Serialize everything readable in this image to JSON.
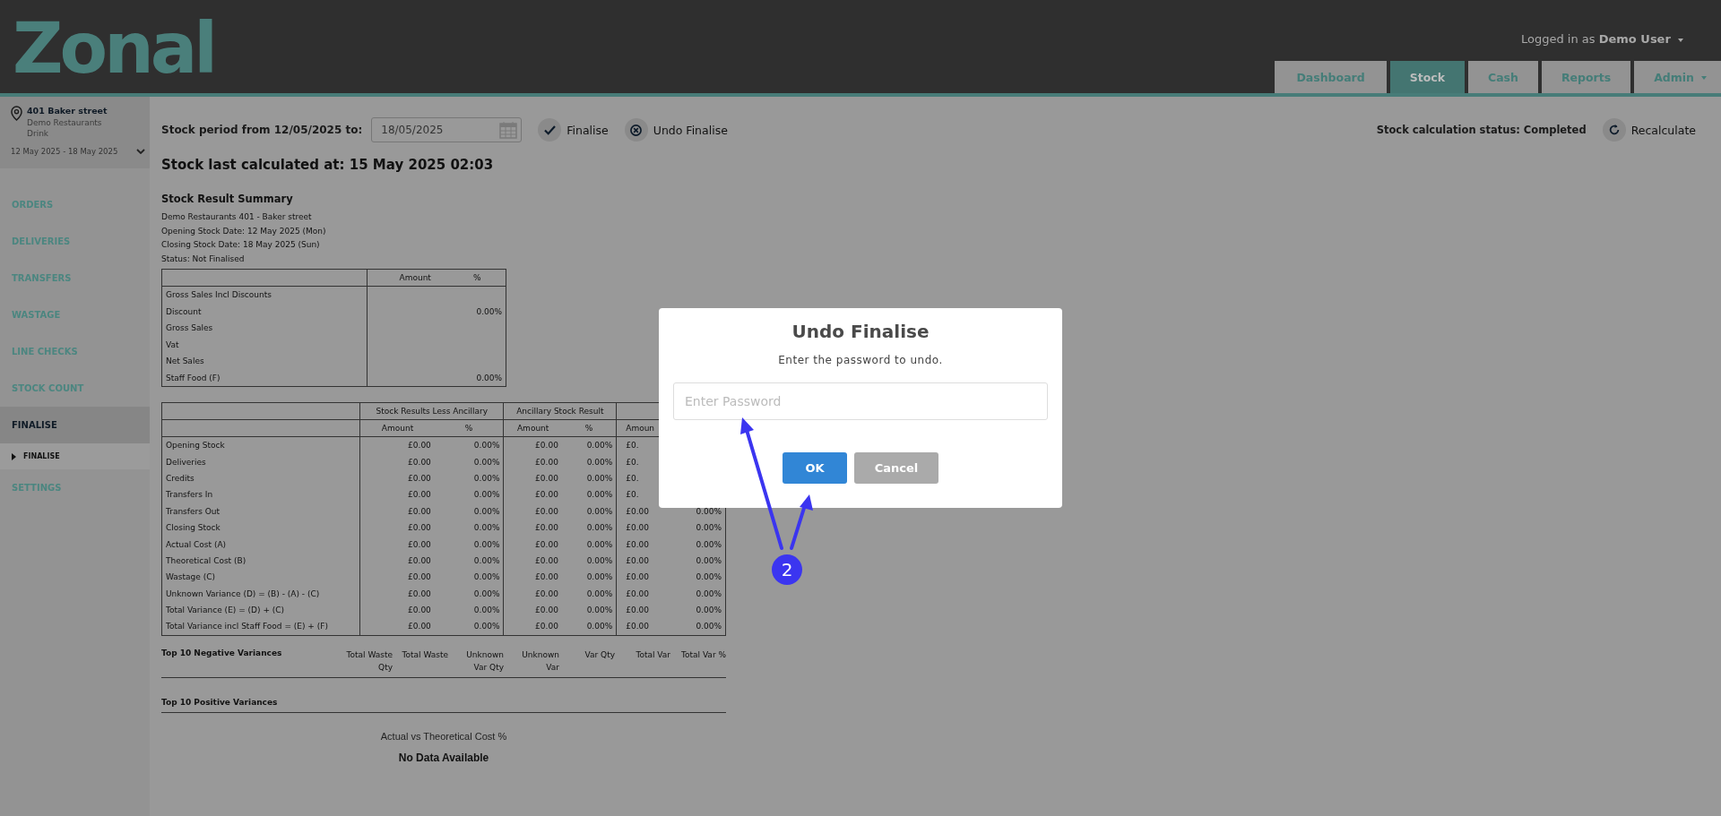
{
  "header": {
    "logo": "Zonal",
    "user_prefix": "Logged in as",
    "user_name": "Demo User"
  },
  "tabs": [
    {
      "label": "Dashboard",
      "selected": false,
      "dropdown": false
    },
    {
      "label": "Stock",
      "selected": true,
      "dropdown": false
    },
    {
      "label": "Cash",
      "selected": false,
      "dropdown": false
    },
    {
      "label": "Reports",
      "selected": false,
      "dropdown": false
    },
    {
      "label": "Admin",
      "selected": false,
      "dropdown": true
    }
  ],
  "sidebar": {
    "location": {
      "name": "401 Baker street",
      "company": "Demo Restaurants",
      "category": "Drink",
      "period": "12 May 2025 - 18 May 2025"
    },
    "items": [
      {
        "label": "ORDERS",
        "selected": false
      },
      {
        "label": "DELIVERIES",
        "selected": false
      },
      {
        "label": "TRANSFERS",
        "selected": false
      },
      {
        "label": "WASTAGE",
        "selected": false
      },
      {
        "label": "LINE CHECKS",
        "selected": false
      },
      {
        "label": "STOCK COUNT",
        "selected": false
      },
      {
        "label": "FINALISE",
        "selected": true,
        "children": [
          {
            "label": "FINALISE",
            "selected": true
          }
        ]
      },
      {
        "label": "SETTINGS",
        "selected": false
      }
    ]
  },
  "toolbar": {
    "period_label": "Stock period from 12/05/2025 to:",
    "date_value": "18/05/2025",
    "finalise": "Finalise",
    "undo_finalise": "Undo Finalise",
    "status": "Stock calculation status: Completed",
    "recalculate": "Recalculate"
  },
  "last_calculated": "Stock last calculated at: 15 May 2025 02:03",
  "summary": {
    "title": "Stock Result Summary",
    "lines": [
      "Demo Restaurants  401 - Baker street",
      "Opening Stock Date: 12 May 2025 (Mon)",
      "Closing Stock Date: 18 May 2025 (Sun)",
      "Status: Not Finalised"
    ],
    "columns": [
      "Amount",
      "%"
    ],
    "rows": [
      {
        "label": "Gross Sales Incl Discounts"
      },
      {
        "label": "Discount",
        "percent": "0.00%"
      },
      {
        "label": "Gross Sales"
      },
      {
        "label": "Vat"
      },
      {
        "label": "Net Sales"
      },
      {
        "label": "Staff Food (F)",
        "percent": "0.00%"
      }
    ]
  },
  "results": {
    "groups": [
      "Stock Results Less Ancillary",
      "Ancillary Stock Result"
    ],
    "subcolumns": [
      "Amount",
      "%",
      "Amount",
      "%",
      "Amoun"
    ],
    "rows": [
      {
        "label": "Opening Stock",
        "values": [
          "£0.00",
          "0.00%",
          "£0.00",
          "0.00%",
          "£0."
        ]
      },
      {
        "label": "Deliveries",
        "values": [
          "£0.00",
          "0.00%",
          "£0.00",
          "0.00%",
          "£0."
        ]
      },
      {
        "label": "Credits",
        "values": [
          "£0.00",
          "0.00%",
          "£0.00",
          "0.00%",
          "£0."
        ]
      },
      {
        "label": "Transfers In",
        "values": [
          "£0.00",
          "0.00%",
          "£0.00",
          "0.00%",
          "£0."
        ]
      },
      {
        "label": "Transfers Out",
        "values": [
          "£0.00",
          "0.00%",
          "£0.00",
          "0.00%",
          "£0.00",
          "0.00%"
        ]
      },
      {
        "label": "Closing Stock",
        "values": [
          "£0.00",
          "0.00%",
          "£0.00",
          "0.00%",
          "£0.00",
          "0.00%"
        ]
      },
      {
        "label": "Actual Cost (A)",
        "values": [
          "£0.00",
          "0.00%",
          "£0.00",
          "0.00%",
          "£0.00",
          "0.00%"
        ]
      },
      {
        "label": "Theoretical Cost (B)",
        "values": [
          "£0.00",
          "0.00%",
          "£0.00",
          "0.00%",
          "£0.00",
          "0.00%"
        ]
      },
      {
        "label": "Wastage (C)",
        "values": [
          "£0.00",
          "0.00%",
          "£0.00",
          "0.00%",
          "£0.00",
          "0.00%"
        ]
      },
      {
        "label": "Unknown Variance (D) = (B) - (A) - (C)",
        "values": [
          "£0.00",
          "0.00%",
          "£0.00",
          "0.00%",
          "£0.00",
          "0.00%"
        ]
      },
      {
        "label": "Total Variance (E) = (D) + (C)",
        "values": [
          "£0.00",
          "0.00%",
          "£0.00",
          "0.00%",
          "£0.00",
          "0.00%"
        ]
      },
      {
        "label": "Total Variance incl Staff Food = (E) + (F)",
        "values": [
          "£0.00",
          "0.00%",
          "£0.00",
          "0.00%",
          "£0.00",
          "0.00%"
        ]
      }
    ]
  },
  "negative_variances": {
    "title": "Top 10 Negative Variances",
    "columns": [
      "Total Waste Qty",
      "Total Waste",
      "Unknown Var Qty",
      "Unknown Var",
      "Var Qty",
      "Total Var",
      "Total Var %"
    ]
  },
  "positive_variances": {
    "title": "Top 10 Positive Variances"
  },
  "chart": {
    "title": "Actual vs Theoretical Cost %",
    "empty": "No Data Available"
  },
  "dialog": {
    "title": "Undo Finalise",
    "message": "Enter the password to undo.",
    "placeholder": "Enter Password",
    "ok": "OK",
    "cancel": "Cancel"
  },
  "annotation": {
    "badge": "2"
  }
}
